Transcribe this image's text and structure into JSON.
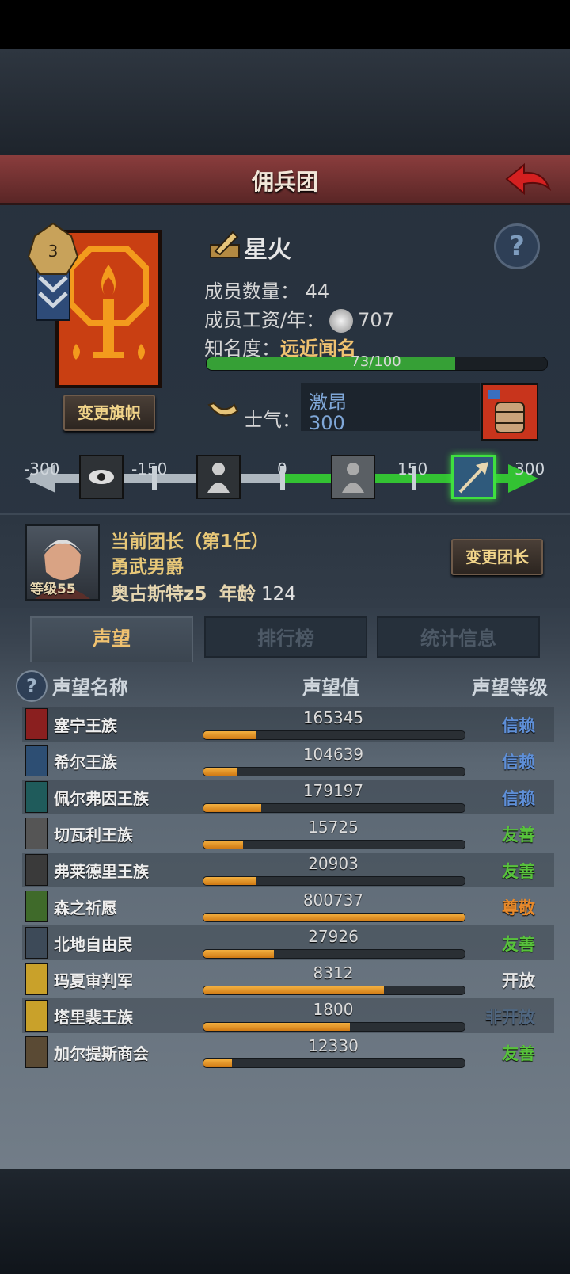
{
  "header": {
    "title": "佣兵团"
  },
  "guild": {
    "name": "星火",
    "banner_button": "变更旗帜",
    "member_count_label": "成员数量：",
    "member_count": "44",
    "salary_label": "成员工资/年：",
    "salary": "707",
    "fame_label": "知名度：",
    "fame_level": "远近闻名",
    "fame_progress_text": "73/100",
    "fame_progress": 0.73,
    "morale_label": "士气：",
    "morale_state": "激昂",
    "morale_value": "300"
  },
  "morale_scale": {
    "ticks": [
      "-300",
      "-150",
      "0",
      "150",
      "300"
    ],
    "current": 300
  },
  "leader": {
    "heading": "当前团长（第1任）",
    "title": "勇武男爵",
    "name": "奥古斯特z5",
    "age_label": "年龄",
    "age": "124",
    "level_text": "等级55",
    "change_button": "变更团长"
  },
  "tabs": [
    {
      "label": "声望",
      "active": true
    },
    {
      "label": "排行榜",
      "active": false
    },
    {
      "label": "统计信息",
      "active": false
    }
  ],
  "reputation": {
    "headers": {
      "name": "声望名称",
      "value": "声望值",
      "level": "声望等级"
    },
    "rows": [
      {
        "name": "塞宁王族",
        "value": "165345",
        "fill": 0.2,
        "level": "信赖",
        "level_color": "#5e8fd8",
        "icon_color": "#8a1f1f"
      },
      {
        "name": "希尔王族",
        "value": "104639",
        "fill": 0.13,
        "level": "信赖",
        "level_color": "#5e8fd8",
        "icon_color": "#2d4e73"
      },
      {
        "name": "佩尔弗因王族",
        "value": "179197",
        "fill": 0.22,
        "level": "信赖",
        "level_color": "#5e8fd8",
        "icon_color": "#1f5b5b"
      },
      {
        "name": "切瓦利王族",
        "value": "15725",
        "fill": 0.15,
        "level": "友善",
        "level_color": "#58c23c",
        "icon_color": "#555555"
      },
      {
        "name": "弗莱德里王族",
        "value": "20903",
        "fill": 0.2,
        "level": "友善",
        "level_color": "#58c23c",
        "icon_color": "#3a3a3a"
      },
      {
        "name": "森之祈愿",
        "value": "800737",
        "fill": 1.0,
        "level": "尊敬",
        "level_color": "#e8892a",
        "icon_color": "#3f6a2a"
      },
      {
        "name": "北地自由民",
        "value": "27926",
        "fill": 0.27,
        "level": "友善",
        "level_color": "#58c23c",
        "icon_color": "#3d4a58"
      },
      {
        "name": "玛夏审判军",
        "value": "8312",
        "fill": 0.69,
        "level": "开放",
        "level_color": "#e6e6e6",
        "icon_color": "#c9a12a"
      },
      {
        "name": "塔里裴王族",
        "value": "1800",
        "fill": 0.56,
        "level": "非开放",
        "level_color": "#4f6680",
        "icon_color": "#c9a12a"
      },
      {
        "name": "加尔提斯商会",
        "value": "12330",
        "fill": 0.11,
        "level": "友善",
        "level_color": "#58c23c",
        "icon_color": "#5a4a34"
      }
    ]
  }
}
